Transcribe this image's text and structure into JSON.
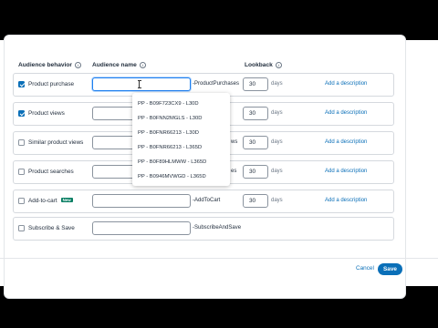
{
  "headers": {
    "behavior": "Audience behavior",
    "name": "Audience name",
    "lookback": "Lookback"
  },
  "rows": [
    {
      "label": "Product purchase",
      "checked": true,
      "suffix": "-ProductPurchases",
      "lookback": "30",
      "unit": "days",
      "desc": "Add a description"
    },
    {
      "label": "Product views",
      "checked": true,
      "suffix": "",
      "lookback": "30",
      "unit": "days",
      "desc": "Add a description"
    },
    {
      "label": "Similar product views",
      "checked": false,
      "suffix": "ws",
      "lookback": "30",
      "unit": "days",
      "desc": "Add a description"
    },
    {
      "label": "Product searches",
      "checked": false,
      "suffix": "es",
      "lookback": "30",
      "unit": "days",
      "desc": "Add a description"
    },
    {
      "label": "Add-to-cart",
      "badge": "New",
      "checked": false,
      "suffix": "-AddToCart",
      "lookback": "30",
      "unit": "days",
      "desc": "Add a description"
    },
    {
      "label": "Subscribe & Save",
      "checked": false,
      "suffix": "-SubscribeAndSave"
    }
  ],
  "dropdown": [
    "PP - B09F723CX9 - L30D",
    "PP - B0FNN2MGLS - L30D",
    "PP - B0FNR66213 - L30D",
    "PP - B0FNR66213 - L365D",
    "PP - B0F89HLMWW - L365D",
    "PP - B0946MVWGD - L365D"
  ],
  "footer": {
    "cancel": "Cancel",
    "save": "Save"
  },
  "colors": {
    "primary": "#0a6fb8",
    "badge": "#067d62",
    "focus": "#1d7ff0"
  }
}
